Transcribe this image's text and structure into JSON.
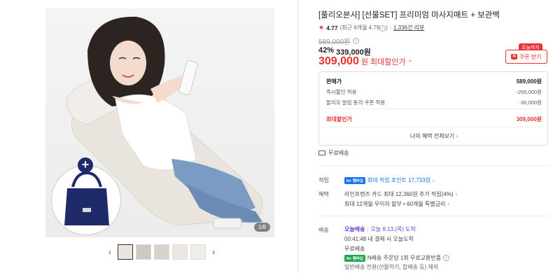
{
  "gallery": {
    "counter": "1/8",
    "prev_icon": "‹",
    "next_icon": "›",
    "thumbnail_count": 5
  },
  "product": {
    "title": "[풀리오본사] [선물SET] 프리미엄 마사지매트 + 보관백",
    "rating": "4.77",
    "rating_recent": "(최근 6개월 4.79",
    "rating_recent_close": ")",
    "review_count": "1,336건 리뷰",
    "original_price": "589,000원",
    "discount_pct": "42%",
    "discount_price": "339,000원",
    "final_price": "309,000",
    "final_unit": "원",
    "final_label": "최대할인가",
    "today_tag": "오늘까지",
    "coupon_label": "쿠폰 받기",
    "coupon_badge": "N"
  },
  "breakdown": {
    "rows": [
      {
        "label": "판매가",
        "value": "589,000원"
      },
      {
        "label": "즉시할인 적용",
        "value": "-250,000원"
      },
      {
        "label": "들리오 알림 동의 쿠폰 적용",
        "value": "-30,000원"
      },
      {
        "label": "최대할인가",
        "value": "309,000원"
      }
    ],
    "all_benefits": "나의 혜택 전체보기"
  },
  "shipping_top": "무료배송",
  "points": {
    "label": "적립",
    "badge": "N+ 멤버십",
    "text": "최대 적립 포인트 17,733원"
  },
  "benefits": {
    "label": "혜택",
    "line1": "라인프렌즈 카드 최대 12,360원 추가 적립(4%)",
    "line2": "최대 12개월 무이자 할부 • 60개월 특별금리"
  },
  "delivery": {
    "label": "배송",
    "today_badge": "오늘배송",
    "today_date": "오늘 8.13.(목) 도착",
    "cutoff": "00:41:48  내 결제 시 오늘도착",
    "free": "무료배송",
    "return_badge": "N+ 멤버십",
    "return_text": "N배송 주문당 1회 무료교환반품",
    "exclude": "일반배송 전환(선물하기, 합배송 등) 제외"
  },
  "colors": {
    "accent_red": "#e8312d",
    "naver_blue": "#1a73e8",
    "bag_navy": "#1e2a6a"
  }
}
